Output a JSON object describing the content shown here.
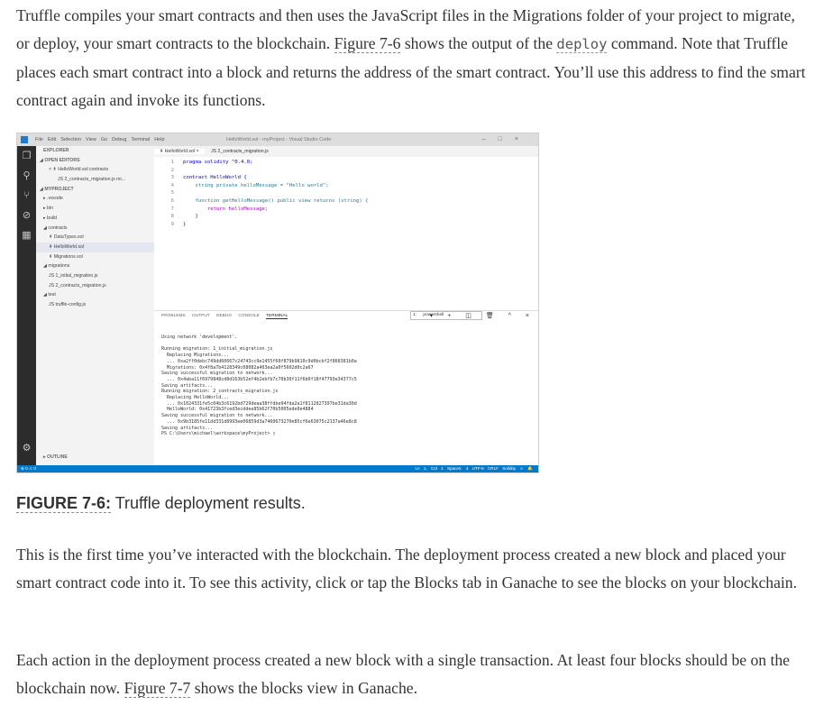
{
  "paragraphs": {
    "p1_a": "Truffle compiles your smart contracts and then uses the JavaScript files in the Migrations folder of your project to migrate, or deploy, your smart contracts to the blockchain.",
    "p1_ref": "Figure 7-6",
    "p1_b": "shows the output of the",
    "p1_code": "deploy",
    "p1_c": "command. Note that Truffle places each smart contract into a block and returns the address of the smart contract. You’ll use this address to find the smart contract again and invoke its functions.",
    "p2": "This is the first time you’ve interacted with the blockchain. The deployment process created a new block and placed your smart contract code into it. To see this activity, click or tap the Blocks tab in Ganache to see the blocks on your blockchain.",
    "p3_a": "Each action in the deployment process created a new block with a single transaction. At least four blocks should be on the blockchain now.",
    "p3_ref": "Figure 7-7",
    "p3_b": "shows the blocks view in Ganache."
  },
  "caption": {
    "label": "FIGURE 7-6:",
    "text": "Truffle deployment results."
  },
  "screenshot": {
    "menu": [
      "File",
      "Edit",
      "Selection",
      "View",
      "Go",
      "Debug",
      "Terminal",
      "Help"
    ],
    "window_title": "HelloWorld.sol - myProject - Visual Studio Code",
    "window_controls": "–□×",
    "sidebar": {
      "explorer": "EXPLORER",
      "open_editors": "◢ OPEN EDITORS",
      "items": [
        "× ⇞ HelloWorld.sol contracts",
        "JS 2_contracts_migration.js mi...",
        "◢ MYPROJECT",
        "▸ .vscode",
        "▸ bin",
        "▸ build",
        "◢ contracts",
        "⇞ DataTypes.sol",
        "⇞ HelloWorld.sol",
        "⇞ Migrations.sol",
        "◢ migrations",
        "JS 1_initial_migration.js",
        "JS 2_contracts_migration.js",
        "◢ test",
        "JS truffle-config.js"
      ],
      "outline": "▸ OUTLINE"
    },
    "tabs": [
      "⇞ HelloWorld.sol ×",
      "JS 2_contracts_migration.js"
    ],
    "code_lines": [
      {
        "n": "1",
        "t": "pragma solidity ^0.4.0;"
      },
      {
        "n": "2",
        "t": ""
      },
      {
        "n": "3",
        "t": "contract HelloWorld {"
      },
      {
        "n": "4",
        "t": "    string private helloMessage = \"Hello world\";"
      },
      {
        "n": "5",
        "t": ""
      },
      {
        "n": "6",
        "t": "    function getHelloMessage() public view returns (string) {"
      },
      {
        "n": "7",
        "t": "        return helloMessage;"
      },
      {
        "n": "8",
        "t": "    }"
      },
      {
        "n": "9",
        "t": "}"
      }
    ],
    "panel_tabs": [
      "PROBLEMS",
      "OUTPUT",
      "DEBUG CONSOLE",
      "TERMINAL"
    ],
    "terminal_select": "1: powershell",
    "terminal_text": "Using network 'development'.\n\nRunning migration: 1_initial_migration.js\n  Replacing Migrations...\n  ... 0xa2ff0debc749dd60667c24743cc9e1455f60f879b9810c9d0bcbf2f868381b0a\n  Migrations: 0x4f8a7b4128349c08082a403ea2a0f5602d0c2a67\nSaving successful migration to network...\n  ... 0x4aba11f6979848cd8d163b52ef4b2ebfb7c70b30f11f6b0f18f47793e34377c5\nSaving artifacts...\nRunning migration: 2_contracts_migration.js\n  Replacing HelloWorld...\n  ... 0x1024331fe5c04b3c6192bd729deaa38ffdbe94fda2a1f8112827397be31da30d\n  HelloWorld: 0x41723b3fced3ecddee85b62f70b5005ede0e4884\nSaving successful migration to network...\n  ... 0x9b3185fe11dd331d8993ee06859d3a7460673270e85cf6e63075c2137a46e8c8\nSaving artifacts...\nPS C:\\Users\\michael\\workspace\\myProject> ▯",
    "status_left": "⊗ 0 ⚠ 0",
    "status_right": "Ln 1, Col 1   Spaces: 4   UTF-8   CRLF   Solidity   ☺ 🔔"
  }
}
